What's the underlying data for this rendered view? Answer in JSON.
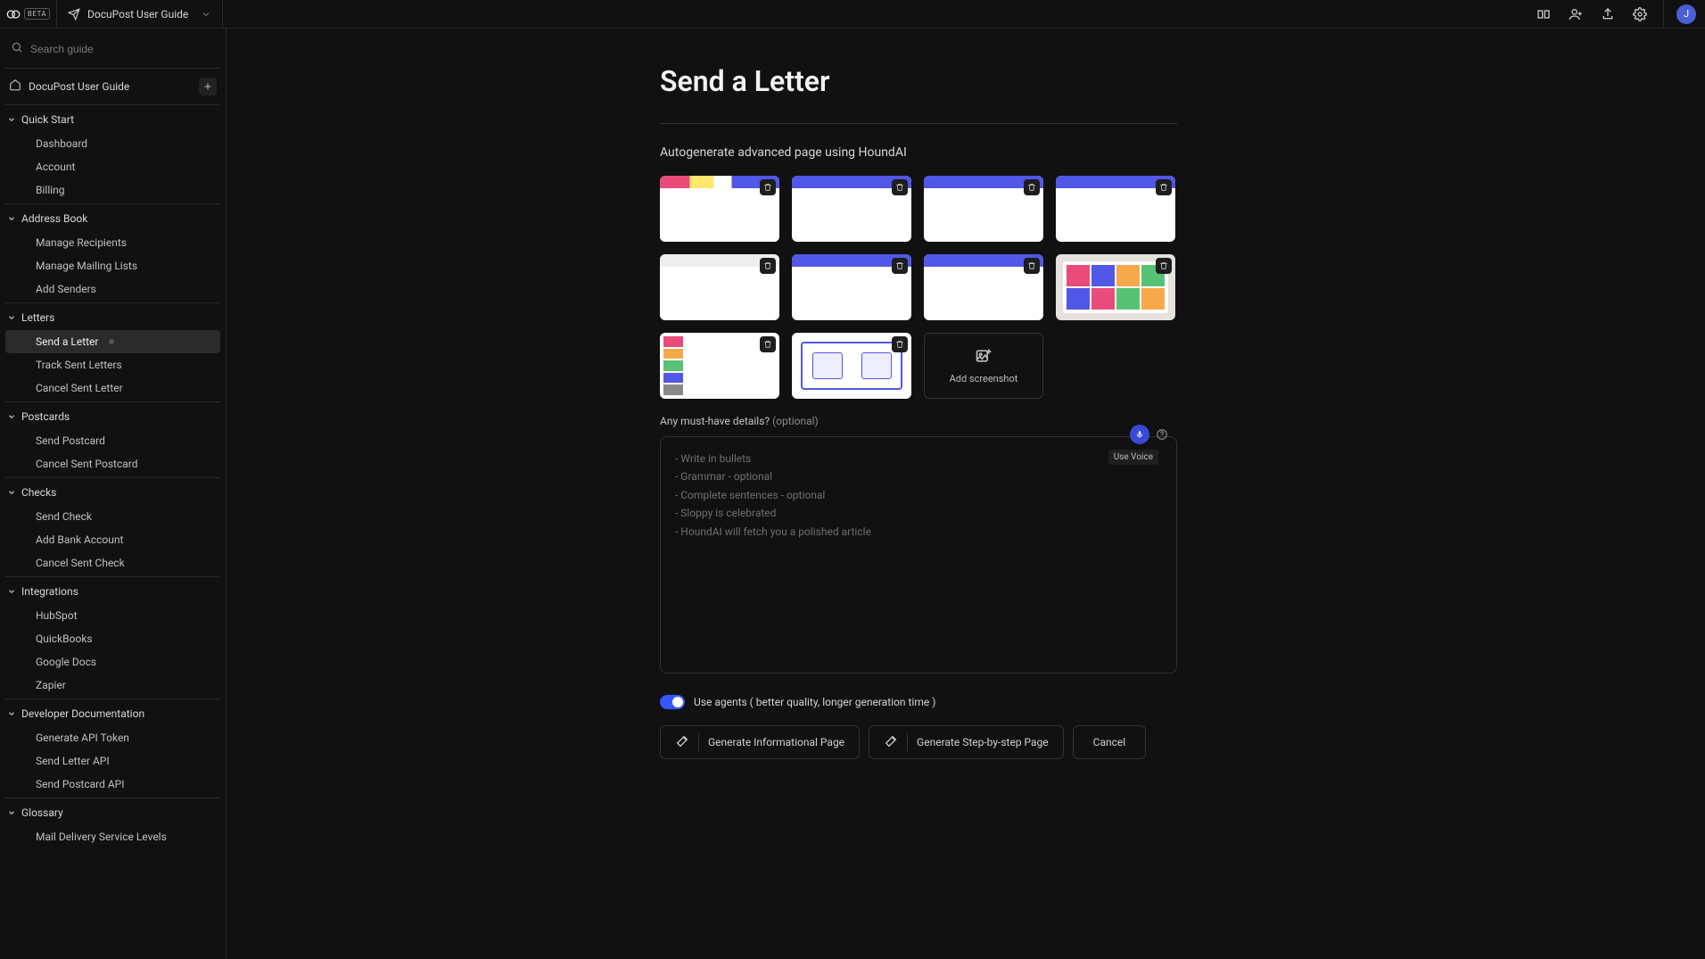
{
  "topbar": {
    "beta_label": "BETA",
    "tab_title": "DocuPost User Guide"
  },
  "avatar_initial": "J",
  "sidebar": {
    "search_placeholder": "Search guide",
    "home_label": "DocuPost User Guide",
    "sections": [
      {
        "label": "Quick Start",
        "items": [
          "Dashboard",
          "Account",
          "Billing"
        ]
      },
      {
        "label": "Address Book",
        "items": [
          "Manage Recipients",
          "Manage Mailing Lists",
          "Add Senders"
        ]
      },
      {
        "label": "Letters",
        "items": [
          "Send a Letter",
          "Track Sent Letters",
          "Cancel Sent Letter"
        ],
        "active_index": 0
      },
      {
        "label": "Postcards",
        "items": [
          "Send Postcard",
          "Cancel Sent Postcard"
        ]
      },
      {
        "label": "Checks",
        "items": [
          "Send Check",
          "Add Bank Account",
          "Cancel Sent Check"
        ]
      },
      {
        "label": "Integrations",
        "items": [
          "HubSpot",
          "QuickBooks",
          "Google Docs",
          "Zapier"
        ]
      },
      {
        "label": "Developer Documentation",
        "items": [
          "Generate API Token",
          "Send Letter API",
          "Send Postcard API"
        ]
      },
      {
        "label": "Glossary",
        "items": [
          "Mail Delivery Service Levels"
        ]
      }
    ]
  },
  "page": {
    "title": "Send a Letter",
    "section_title": "Autogenerate advanced page using HoundAI",
    "add_screenshot_label": "Add screenshot",
    "details_label": "Any must-have details? ",
    "details_optional": "(optional)",
    "use_voice_label": "Use Voice",
    "textarea_placeholder": "- Write in bullets\n- Grammar - optional\n- Complete sentences - optional\n- Sloppy is celebrated\n- HoundAI will fetch you a polished article",
    "toggle_label": "Use agents ( better quality, longer generation time )",
    "btn_info": "Generate Informational Page",
    "btn_step": "Generate Step-by-step Page",
    "btn_cancel": "Cancel"
  }
}
